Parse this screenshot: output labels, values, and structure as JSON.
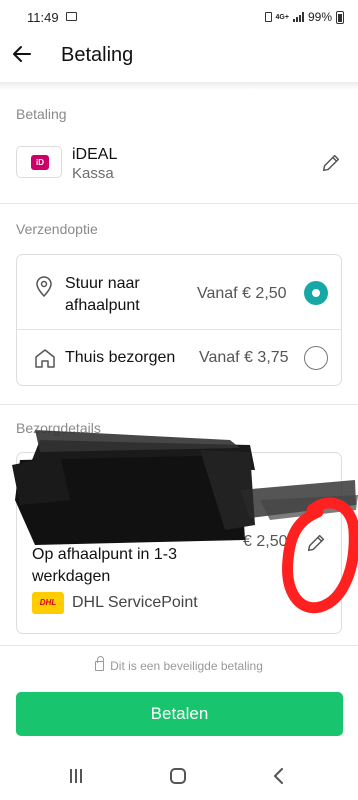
{
  "status_bar": {
    "time": "11:49",
    "network": "4G+",
    "battery": "99%",
    "icons": [
      "gallery-icon",
      "sim-icon",
      "signal-icon",
      "battery-icon"
    ]
  },
  "header": {
    "title": "Betaling",
    "back_icon": "arrow-left-icon"
  },
  "payment_section": {
    "label": "Betaling",
    "method_name": "iDEAL",
    "method_sub": "Kassa",
    "logo_text": "iD",
    "edit_icon": "pencil-icon"
  },
  "shipping_section": {
    "label": "Verzendoptie",
    "options": [
      {
        "label": "Stuur naar afhaalpunt",
        "price": "Vanaf € 2,50",
        "icon": "map-pin-icon",
        "selected": true
      },
      {
        "label": "Thuis bezorgen",
        "price": "Vanaf € 3,75",
        "icon": "house-icon",
        "selected": false
      }
    ],
    "accent_color": "#17a7a7"
  },
  "delivery_section": {
    "label": "Bezorgdetails",
    "delivery_text": "Op afhaalpunt in 1-3 werkdagen",
    "price": "€ 2,50",
    "carrier_name": "DHL ServicePoint",
    "carrier_logo_text": "DHL",
    "edit_icon": "pencil-icon",
    "redaction": "black scribble over address",
    "annotation": "red circle around edit pencil"
  },
  "footer": {
    "secure_text": "Dit is een beveiligde betaling",
    "pay_button": "Betalen",
    "button_color": "#18c46e"
  },
  "nav_bar": {
    "icons": [
      "recent-apps-icon",
      "home-icon",
      "back-icon"
    ]
  }
}
